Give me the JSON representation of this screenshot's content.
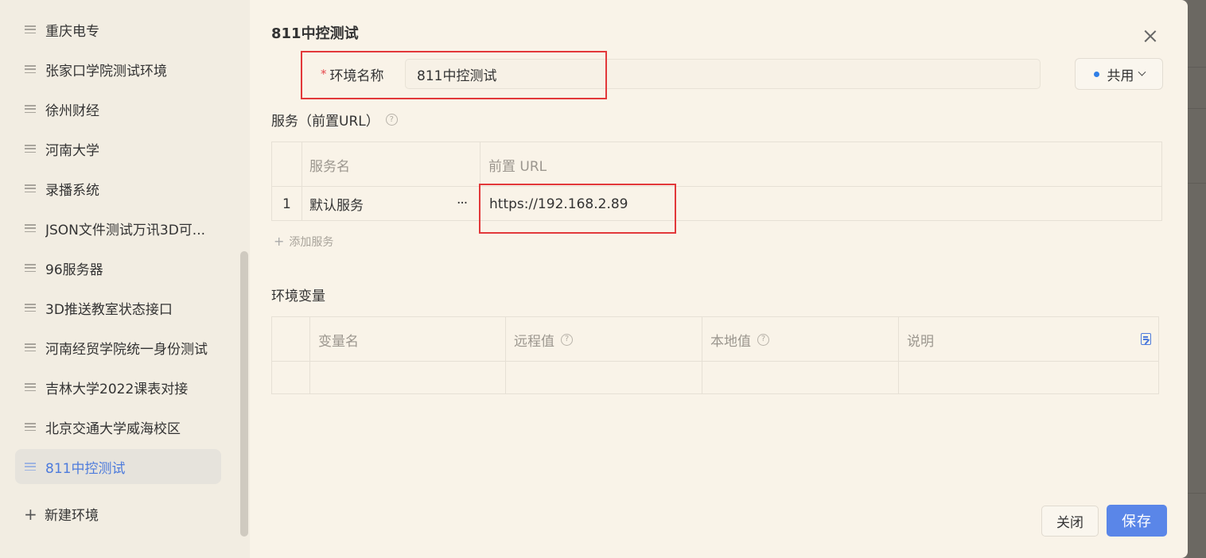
{
  "sidebar": {
    "items": [
      {
        "label": "重庆电专"
      },
      {
        "label": "张家口学院测试环境"
      },
      {
        "label": "徐州财经"
      },
      {
        "label": "河南大学"
      },
      {
        "label": "录播系统"
      },
      {
        "label": "JSON文件测试万讯3D可..."
      },
      {
        "label": "96服务器"
      },
      {
        "label": "3D推送教室状态接口"
      },
      {
        "label": "河南经贸学院统一身份测试"
      },
      {
        "label": "吉林大学2022课表对接"
      },
      {
        "label": "北京交通大学威海校区"
      },
      {
        "label": "811中控测试"
      }
    ],
    "active_index": 11,
    "new_env_label": "新建环境"
  },
  "dialog": {
    "title": "811中控测试",
    "env_name_label": "环境名称",
    "required_mark": "*",
    "env_name_value": "811中控测试",
    "share_label": "共用",
    "share_dot_color": "#2f7fe6"
  },
  "services": {
    "section_title": "服务（前置URL）",
    "columns": [
      "服务名",
      "前置 URL"
    ],
    "rows": [
      {
        "index": "1",
        "name": "默认服务",
        "more": "···",
        "url": "https://192.168.2.89"
      }
    ],
    "add_label": "添加服务"
  },
  "variables": {
    "section_title": "环境变量",
    "columns": [
      "变量名",
      "远程值",
      "本地值",
      "说明"
    ]
  },
  "footer": {
    "close_label": "关闭",
    "save_label": "保存"
  },
  "colors": {
    "accent": "#5a86e8",
    "active_text": "#4d7bdc",
    "highlight_box": "#e2383a",
    "required": "#e5484d"
  }
}
